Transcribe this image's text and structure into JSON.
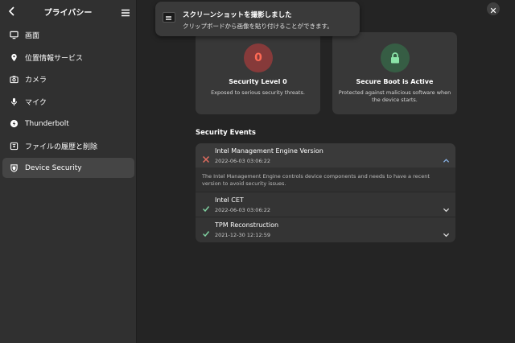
{
  "sidebar": {
    "title": "プライバシー",
    "items": [
      {
        "label": "画面",
        "icon": "monitor-icon"
      },
      {
        "label": "位置情報サービス",
        "icon": "location-pin-icon"
      },
      {
        "label": "カメラ",
        "icon": "camera-icon"
      },
      {
        "label": "マイク",
        "icon": "microphone-icon"
      },
      {
        "label": "Thunderbolt",
        "icon": "thunderbolt-icon"
      },
      {
        "label": "ファイルの履歴と削除",
        "icon": "file-history-icon"
      },
      {
        "label": "Device Security",
        "icon": "shield-icon",
        "active": true
      }
    ]
  },
  "toast": {
    "title": "スクリーンショットを撮影しました",
    "body": "クリップボードから画像を貼り付けることができます。"
  },
  "cards": {
    "level": {
      "icon_text": "0",
      "title": "Security Level 0",
      "subtitle": "Exposed to serious security threats.",
      "color": "#863a3a"
    },
    "secure_boot": {
      "title": "Secure Boot is Active",
      "subtitle": "Protected against malicious software when the device starts.",
      "color": "#365d44"
    }
  },
  "events": {
    "heading": "Security Events",
    "items": [
      {
        "title": "Intel Management Engine Version",
        "date": "2022-06-03 03:06:22",
        "status": "fail",
        "expanded": true,
        "detail": "The Intel Management Engine controls device components and needs to have a recent version to avoid security issues."
      },
      {
        "title": "Intel CET",
        "date": "2022-06-03 03:06:22",
        "status": "pass"
      },
      {
        "title": "TPM Reconstruction",
        "date": "2021-12-30 12:12:59",
        "status": "pass"
      }
    ]
  },
  "colors": {
    "fail": "#e06c5f",
    "pass": "#7fd0a0",
    "accent_chevron": "#8ab4e8"
  }
}
